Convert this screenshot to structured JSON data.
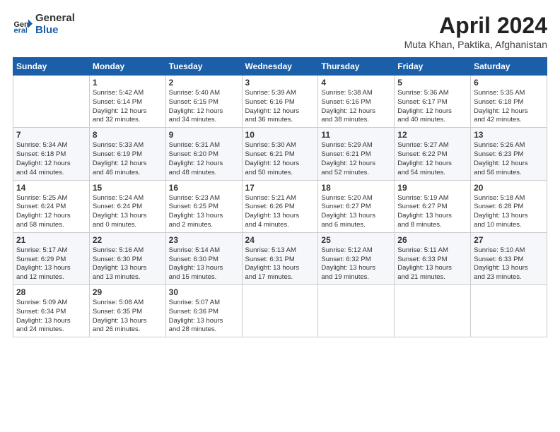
{
  "logo": {
    "general": "General",
    "blue": "Blue"
  },
  "title": "April 2024",
  "location": "Muta Khan, Paktika, Afghanistan",
  "days_header": [
    "Sunday",
    "Monday",
    "Tuesday",
    "Wednesday",
    "Thursday",
    "Friday",
    "Saturday"
  ],
  "weeks": [
    [
      {
        "day": "",
        "info": ""
      },
      {
        "day": "1",
        "info": "Sunrise: 5:42 AM\nSunset: 6:14 PM\nDaylight: 12 hours\nand 32 minutes."
      },
      {
        "day": "2",
        "info": "Sunrise: 5:40 AM\nSunset: 6:15 PM\nDaylight: 12 hours\nand 34 minutes."
      },
      {
        "day": "3",
        "info": "Sunrise: 5:39 AM\nSunset: 6:16 PM\nDaylight: 12 hours\nand 36 minutes."
      },
      {
        "day": "4",
        "info": "Sunrise: 5:38 AM\nSunset: 6:16 PM\nDaylight: 12 hours\nand 38 minutes."
      },
      {
        "day": "5",
        "info": "Sunrise: 5:36 AM\nSunset: 6:17 PM\nDaylight: 12 hours\nand 40 minutes."
      },
      {
        "day": "6",
        "info": "Sunrise: 5:35 AM\nSunset: 6:18 PM\nDaylight: 12 hours\nand 42 minutes."
      }
    ],
    [
      {
        "day": "7",
        "info": "Sunrise: 5:34 AM\nSunset: 6:18 PM\nDaylight: 12 hours\nand 44 minutes."
      },
      {
        "day": "8",
        "info": "Sunrise: 5:33 AM\nSunset: 6:19 PM\nDaylight: 12 hours\nand 46 minutes."
      },
      {
        "day": "9",
        "info": "Sunrise: 5:31 AM\nSunset: 6:20 PM\nDaylight: 12 hours\nand 48 minutes."
      },
      {
        "day": "10",
        "info": "Sunrise: 5:30 AM\nSunset: 6:21 PM\nDaylight: 12 hours\nand 50 minutes."
      },
      {
        "day": "11",
        "info": "Sunrise: 5:29 AM\nSunset: 6:21 PM\nDaylight: 12 hours\nand 52 minutes."
      },
      {
        "day": "12",
        "info": "Sunrise: 5:27 AM\nSunset: 6:22 PM\nDaylight: 12 hours\nand 54 minutes."
      },
      {
        "day": "13",
        "info": "Sunrise: 5:26 AM\nSunset: 6:23 PM\nDaylight: 12 hours\nand 56 minutes."
      }
    ],
    [
      {
        "day": "14",
        "info": "Sunrise: 5:25 AM\nSunset: 6:24 PM\nDaylight: 12 hours\nand 58 minutes."
      },
      {
        "day": "15",
        "info": "Sunrise: 5:24 AM\nSunset: 6:24 PM\nDaylight: 13 hours\nand 0 minutes."
      },
      {
        "day": "16",
        "info": "Sunrise: 5:23 AM\nSunset: 6:25 PM\nDaylight: 13 hours\nand 2 minutes."
      },
      {
        "day": "17",
        "info": "Sunrise: 5:21 AM\nSunset: 6:26 PM\nDaylight: 13 hours\nand 4 minutes."
      },
      {
        "day": "18",
        "info": "Sunrise: 5:20 AM\nSunset: 6:27 PM\nDaylight: 13 hours\nand 6 minutes."
      },
      {
        "day": "19",
        "info": "Sunrise: 5:19 AM\nSunset: 6:27 PM\nDaylight: 13 hours\nand 8 minutes."
      },
      {
        "day": "20",
        "info": "Sunrise: 5:18 AM\nSunset: 6:28 PM\nDaylight: 13 hours\nand 10 minutes."
      }
    ],
    [
      {
        "day": "21",
        "info": "Sunrise: 5:17 AM\nSunset: 6:29 PM\nDaylight: 13 hours\nand 12 minutes."
      },
      {
        "day": "22",
        "info": "Sunrise: 5:16 AM\nSunset: 6:30 PM\nDaylight: 13 hours\nand 13 minutes."
      },
      {
        "day": "23",
        "info": "Sunrise: 5:14 AM\nSunset: 6:30 PM\nDaylight: 13 hours\nand 15 minutes."
      },
      {
        "day": "24",
        "info": "Sunrise: 5:13 AM\nSunset: 6:31 PM\nDaylight: 13 hours\nand 17 minutes."
      },
      {
        "day": "25",
        "info": "Sunrise: 5:12 AM\nSunset: 6:32 PM\nDaylight: 13 hours\nand 19 minutes."
      },
      {
        "day": "26",
        "info": "Sunrise: 5:11 AM\nSunset: 6:33 PM\nDaylight: 13 hours\nand 21 minutes."
      },
      {
        "day": "27",
        "info": "Sunrise: 5:10 AM\nSunset: 6:33 PM\nDaylight: 13 hours\nand 23 minutes."
      }
    ],
    [
      {
        "day": "28",
        "info": "Sunrise: 5:09 AM\nSunset: 6:34 PM\nDaylight: 13 hours\nand 24 minutes."
      },
      {
        "day": "29",
        "info": "Sunrise: 5:08 AM\nSunset: 6:35 PM\nDaylight: 13 hours\nand 26 minutes."
      },
      {
        "day": "30",
        "info": "Sunrise: 5:07 AM\nSunset: 6:36 PM\nDaylight: 13 hours\nand 28 minutes."
      },
      {
        "day": "",
        "info": ""
      },
      {
        "day": "",
        "info": ""
      },
      {
        "day": "",
        "info": ""
      },
      {
        "day": "",
        "info": ""
      }
    ]
  ]
}
